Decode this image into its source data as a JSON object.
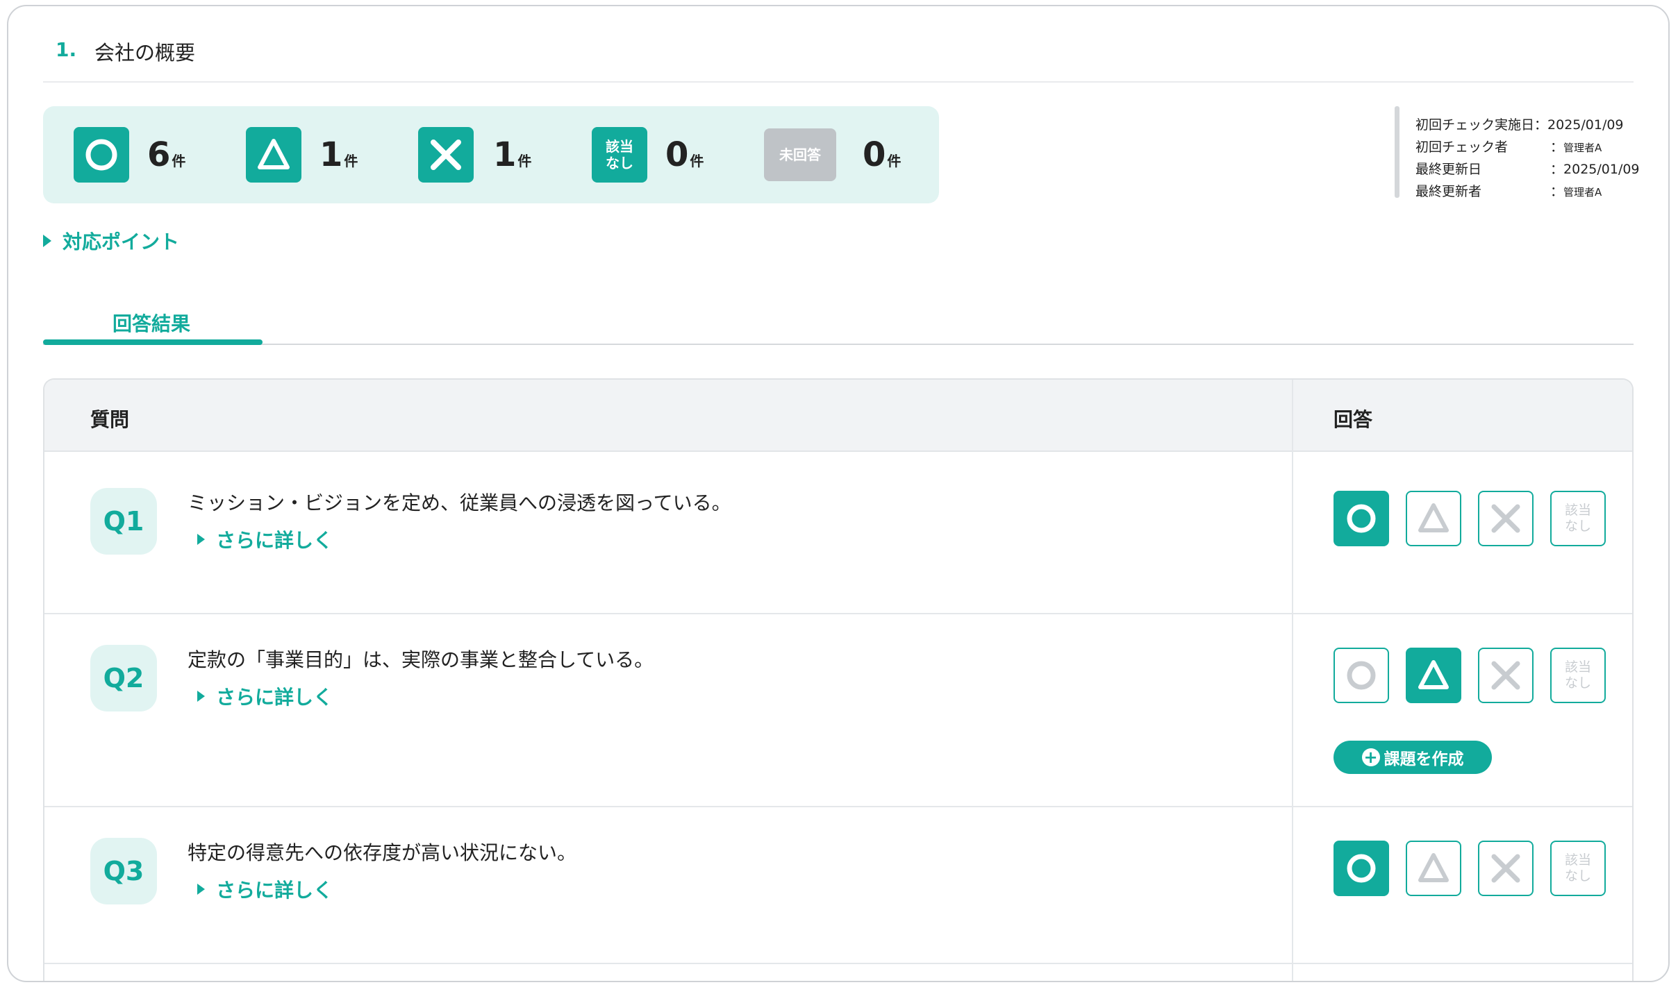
{
  "section": {
    "number": "1.",
    "title": "会社の概要"
  },
  "summary": [
    {
      "icon": "circle-icon",
      "count": "6",
      "unit": "件"
    },
    {
      "icon": "triangle-icon",
      "count": "1",
      "unit": "件"
    },
    {
      "icon": "cross-icon",
      "count": "1",
      "unit": "件"
    },
    {
      "icon": "not-applicable-icon",
      "icon_text": [
        "該当",
        "なし"
      ],
      "count": "0",
      "unit": "件"
    },
    {
      "icon": "unanswered-icon",
      "icon_text": "未回答",
      "count": "0",
      "unit": "件"
    }
  ],
  "meta": {
    "first_check_date_label": "初回チェック実施日：",
    "first_check_date": "2025/01/09",
    "first_checker_label": "初回チェック者",
    "first_checker": "管理者A",
    "last_updated_label": "最終更新日",
    "last_updated": "2025/01/09",
    "last_updater_label": "最終更新者",
    "last_updater": "管理者A",
    "colon": "："
  },
  "points_label": "対応ポイント",
  "tab_label": "回答結果",
  "table": {
    "col_question": "質問",
    "col_answer": "回答",
    "more_label": "さらに詳しく",
    "na_text": [
      "該当",
      "なし"
    ],
    "create_task_label": "課題を作成",
    "rows": [
      {
        "id": "Q1",
        "text": "ミッション・ビジョンを定め、従業員への浸透を図っている。",
        "answer": "circle"
      },
      {
        "id": "Q2",
        "text": "定款の「事業目的」は、実際の事業と整合している。",
        "answer": "triangle"
      },
      {
        "id": "Q3",
        "text": "特定の得意先への依存度が高い状況にない。",
        "answer": "circle"
      }
    ]
  },
  "colors": {
    "accent": "#12ab9c",
    "accent_light": "#e1f4f2",
    "unanswered_gray": "#bfc3c7",
    "inactive_icon": "#c8ccd0"
  }
}
